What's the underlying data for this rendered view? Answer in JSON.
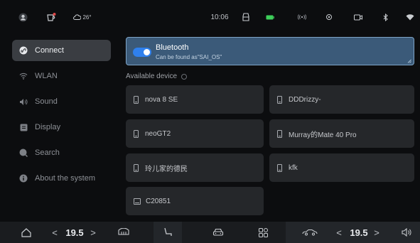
{
  "status_bar": {
    "weather": "26°",
    "time": "10:06",
    "icons": [
      "avatar-icon",
      "cup-icon",
      "cloud-icon",
      "car-icon",
      "battery-icon",
      "broadcast-icon",
      "location-icon",
      "camera-icon",
      "bluetooth-icon",
      "wifi-icon"
    ]
  },
  "sidebar": {
    "items": [
      {
        "label": "Connect",
        "icon": "link-icon",
        "active": true
      },
      {
        "label": "WLAN",
        "icon": "wifi-icon",
        "active": false
      },
      {
        "label": "Sound",
        "icon": "speaker-icon",
        "active": false
      },
      {
        "label": "Display",
        "icon": "display-icon",
        "active": false
      },
      {
        "label": "Search",
        "icon": "search-icon",
        "active": false
      },
      {
        "label": "About the system",
        "icon": "info-icon",
        "active": false
      }
    ]
  },
  "bluetooth": {
    "title": "Bluetooth",
    "subtitle": "Can be found as\"SAI_OS\"",
    "enabled": true
  },
  "devices": {
    "label": "Available device",
    "list": [
      {
        "name": "nova 8 SE",
        "type": "phone"
      },
      {
        "name": "DDDrizzy-",
        "type": "phone"
      },
      {
        "name": "neoGT2",
        "type": "phone"
      },
      {
        "name": "Murray的Mate 40 Pro",
        "type": "phone"
      },
      {
        "name": "玲儿家的德民",
        "type": "phone"
      },
      {
        "name": "kfk",
        "type": "phone"
      },
      {
        "name": "C20851",
        "type": "computer"
      }
    ]
  },
  "bottom_bar": {
    "left_temp": "19.5",
    "right_temp": "19.5",
    "left_arrow": "<",
    "right_arrow": ">",
    "icons": [
      "home-icon",
      "rear-defrost-icon",
      "seat-icon",
      "car-front-icon",
      "apps-icon",
      "car-side-icon",
      "volume-icon"
    ]
  },
  "colors": {
    "accent": "#2f80ed",
    "bluetooth_card": "#3b5a79",
    "device_card": "#25272a",
    "sidebar_active": "#3a3d42",
    "battery": "#3ecf5a",
    "status_red": "#e04848"
  }
}
